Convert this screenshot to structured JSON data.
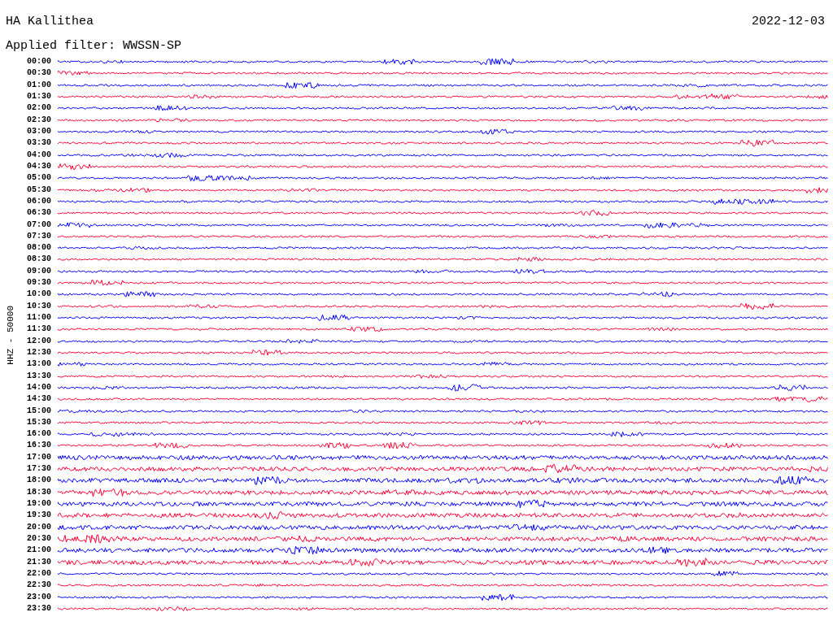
{
  "station": "HA Kallithea",
  "date": "2022-12-03",
  "filter": "Applied filter: WWSSN-SP",
  "axis_label": "HHZ - 50000",
  "rows": [
    {
      "time": "00:00",
      "color": "#0000ff"
    },
    {
      "time": "00:30",
      "color": "#ff0033"
    },
    {
      "time": "01:00",
      "color": "#0000ff"
    },
    {
      "time": "01:30",
      "color": "#ff0033"
    },
    {
      "time": "02:00",
      "color": "#0000ff"
    },
    {
      "time": "02:30",
      "color": "#ff0033"
    },
    {
      "time": "03:00",
      "color": "#0000ff"
    },
    {
      "time": "03:30",
      "color": "#ff0033"
    },
    {
      "time": "04:00",
      "color": "#0000ff"
    },
    {
      "time": "04:30",
      "color": "#ff0033"
    },
    {
      "time": "05:00",
      "color": "#0000ff"
    },
    {
      "time": "05:30",
      "color": "#ff0033"
    },
    {
      "time": "06:00",
      "color": "#0000ff"
    },
    {
      "time": "06:30",
      "color": "#ff0033"
    },
    {
      "time": "07:00",
      "color": "#0000ff"
    },
    {
      "time": "07:30",
      "color": "#ff0033"
    },
    {
      "time": "08:00",
      "color": "#0000ff"
    },
    {
      "time": "08:30",
      "color": "#ff0033"
    },
    {
      "time": "09:00",
      "color": "#0000ff"
    },
    {
      "time": "09:30",
      "color": "#ff0033"
    },
    {
      "time": "10:00",
      "color": "#0000ff"
    },
    {
      "time": "10:30",
      "color": "#ff0033"
    },
    {
      "time": "11:00",
      "color": "#0000ff"
    },
    {
      "time": "11:30",
      "color": "#ff0033"
    },
    {
      "time": "12:00",
      "color": "#0000ff"
    },
    {
      "time": "12:30",
      "color": "#ff0033"
    },
    {
      "time": "13:00",
      "color": "#0000ff"
    },
    {
      "time": "13:30",
      "color": "#ff0033"
    },
    {
      "time": "14:00",
      "color": "#0000ff"
    },
    {
      "time": "14:30",
      "color": "#ff0033"
    },
    {
      "time": "15:00",
      "color": "#0000ff"
    },
    {
      "time": "15:30",
      "color": "#ff0033"
    },
    {
      "time": "16:00",
      "color": "#0000ff"
    },
    {
      "time": "16:30",
      "color": "#ff0033"
    },
    {
      "time": "17:00",
      "color": "#0000ff"
    },
    {
      "time": "17:30",
      "color": "#ff0033"
    },
    {
      "time": "18:00",
      "color": "#0000ff"
    },
    {
      "time": "18:30",
      "color": "#ff0033"
    },
    {
      "time": "19:00",
      "color": "#0000ff"
    },
    {
      "time": "19:30",
      "color": "#ff0033"
    },
    {
      "time": "20:00",
      "color": "#0000ff"
    },
    {
      "time": "20:30",
      "color": "#ff0033"
    },
    {
      "time": "21:00",
      "color": "#0000ff"
    },
    {
      "time": "21:30",
      "color": "#ff0033"
    },
    {
      "time": "22:00",
      "color": "#0000ff"
    },
    {
      "time": "22:30",
      "color": "#ff0033"
    },
    {
      "time": "23:00",
      "color": "#0000ff"
    },
    {
      "time": "23:30",
      "color": "#ff0033"
    }
  ]
}
